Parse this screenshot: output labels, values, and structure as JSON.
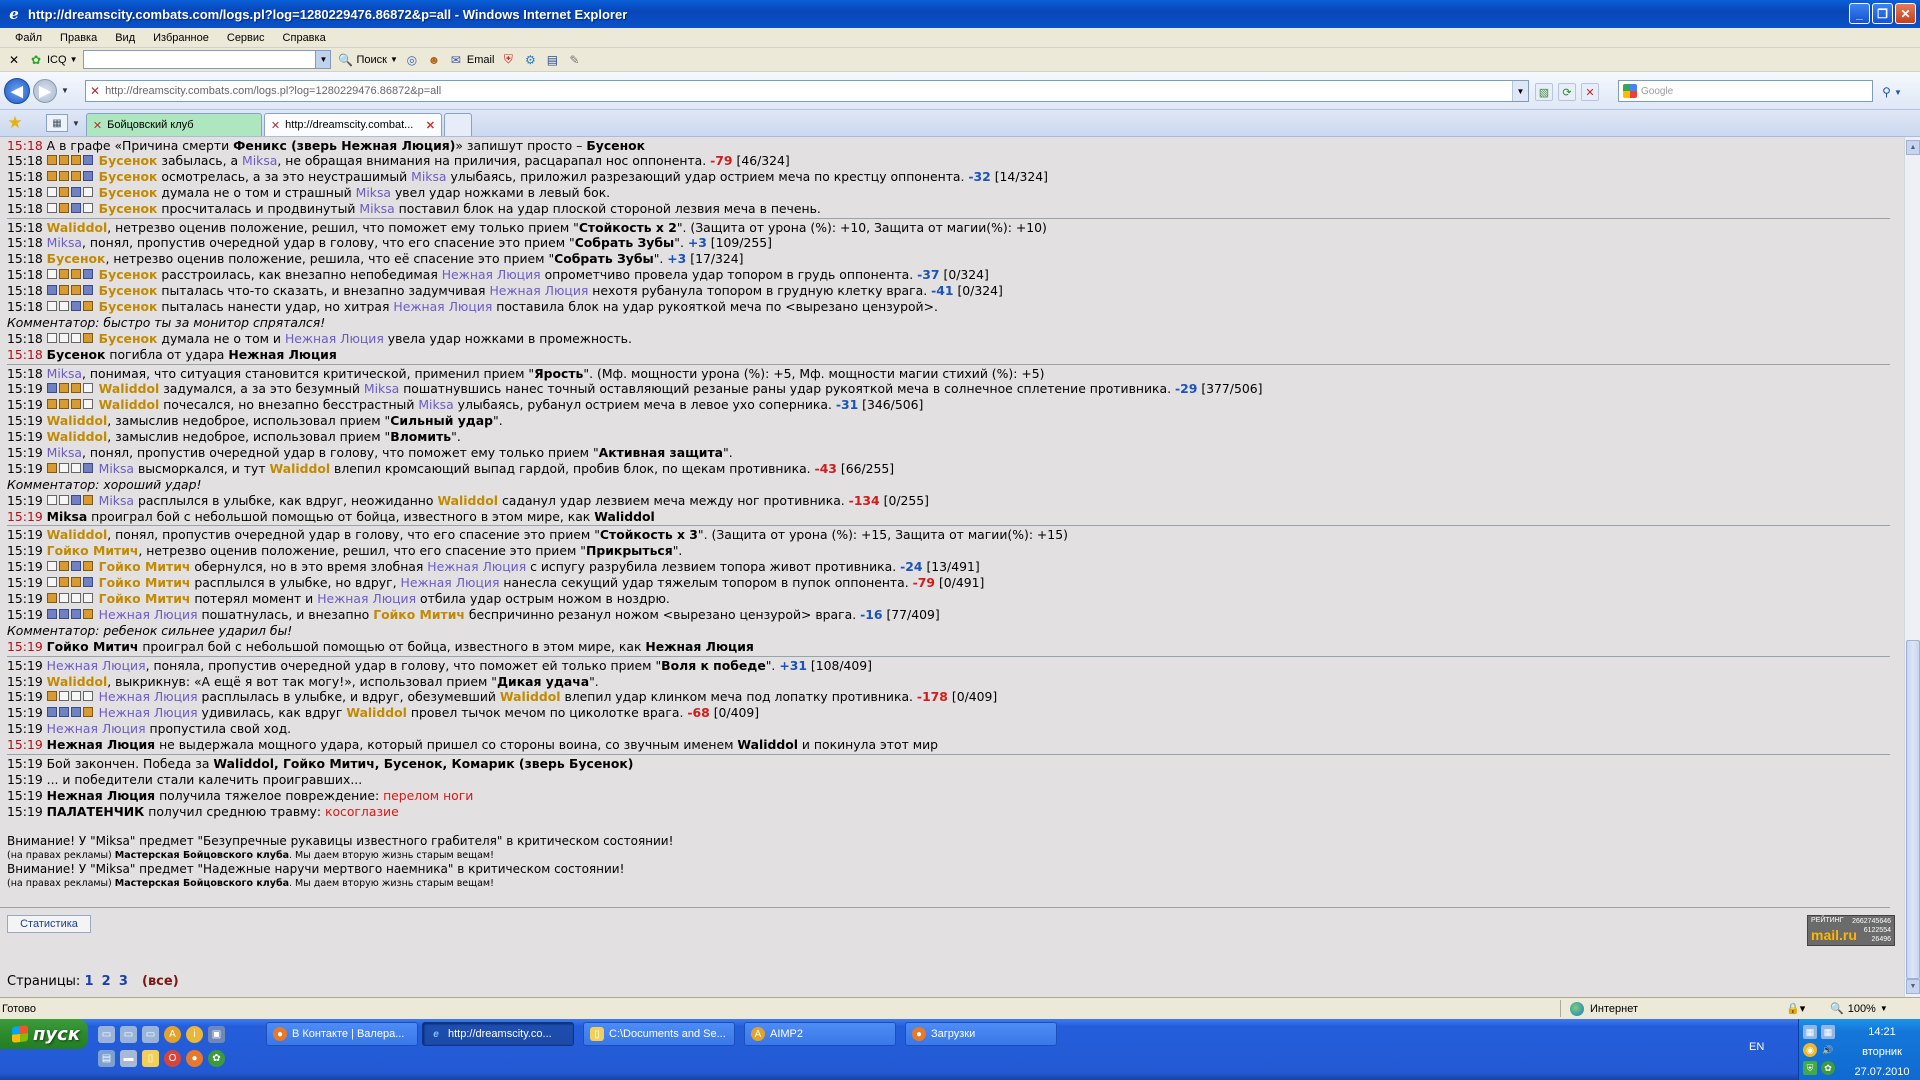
{
  "window": {
    "title": "http://dreamscity.combats.com/logs.pl?log=1280229476.86872&p=all - Windows Internet Explorer",
    "btn_min": "_",
    "btn_max": "❐",
    "btn_close": "✕"
  },
  "menu": [
    "Файл",
    "Правка",
    "Вид",
    "Избранное",
    "Сервис",
    "Справка"
  ],
  "toolbar": {
    "icq_label": "ICQ",
    "search_label": "Поиск",
    "email_label": "Email"
  },
  "address": {
    "url": "http://dreamscity.combats.com/logs.pl?log=1280229476.86872&p=all",
    "search_placeholder": "Google"
  },
  "tabs": [
    {
      "label": "Бойцовский клуб"
    },
    {
      "label": "http://dreamscity.combat..."
    }
  ],
  "log": [
    {
      "t": "15:18",
      "red": true,
      "first": true,
      "html": "А в графе «Причина смерти <span class=\"b\">Феникс (зверь Нежная Люция)</span>» запишут просто – <span class=\"b\">Бусенок</span>"
    },
    {
      "t": "15:18",
      "ico": "fffb",
      "html": "<span class=\"p1\">Бусенок</span> забылась, а <span class=\"p2\">Miksa</span>, не обращая внимания на приличия, расцарапал нос оппонента. <span class=\"dmg\">-79</span> [46/324]"
    },
    {
      "t": "15:18",
      "ico": "fffb",
      "html": "<span class=\"p1\">Бусенок</span> осмотрелась, а за это неустрашимый <span class=\"p2\">Miksa</span> улыбаясь, приложил разрезающий удар острием меча по крестцу оппонента. <span class=\"heal\">-32</span> [14/324]"
    },
    {
      "t": "15:18",
      "ico": "efbe",
      "html": "<span class=\"p1\">Бусенок</span> думала не о том и страшный <span class=\"p2\">Miksa</span> увел удар ножками в левый бок."
    },
    {
      "t": "15:18",
      "ico": "efbe",
      "html": "<span class=\"p1\">Бусенок</span> просчиталась и продвинутый <span class=\"p2\">Miksa</span> поставил блок на удар плоской стороной лезвия меча в печень."
    },
    {
      "sep": true
    },
    {
      "t": "15:18",
      "html": "<span class=\"p1\">Waliddol</span>, нетрезво оценив положение, решил, что поможет ему только прием \"<span class=\"b\">Стойкость x 2</span>\". (Защита от урона (%): +10, Защита от магии(%): +10)"
    },
    {
      "t": "15:18",
      "html": "<span class=\"p2\">Miksa</span>, понял, пропустив очередной удар в голову, что его спасение это прием \"<span class=\"b\">Собрать Зубы</span>\". <span class=\"heal\">+3</span> [109/255]"
    },
    {
      "t": "15:18",
      "html": "<span class=\"p1\">Бусенок</span>, нетрезво оценив положение, решила, что её спасение это прием \"<span class=\"b\">Собрать Зубы</span>\". <span class=\"heal\">+3</span> [17/324]"
    },
    {
      "t": "15:18",
      "ico": "effb",
      "html": "<span class=\"p1\">Бусенок</span> расстроилась, как внезапно непобедимая <span class=\"p2\">Нежная Люция</span> опрометчиво провела удар топором в грудь оппонента. <span class=\"heal\">-37</span> [0/324]"
    },
    {
      "t": "15:18",
      "ico": "bffb",
      "html": "<span class=\"p1\">Бусенок</span> пыталась что-то сказать, и внезапно задумчивая <span class=\"p2\">Нежная Люция</span> нехотя рубанула топором в грудную клетку врага. <span class=\"heal\">-41</span> [0/324]"
    },
    {
      "t": "15:18",
      "ico": "eebf",
      "html": "<span class=\"p1\">Бусенок</span> пыталась нанести удар, но хитрая <span class=\"p2\">Нежная Люция</span> поставила блок на удар рукояткой меча по &lt;вырезано цензурой&gt;."
    },
    {
      "com": true,
      "html": "Комментатор: быстро ты за монитор спрятался!"
    },
    {
      "t": "15:18",
      "ico": "eeef",
      "html": "<span class=\"p1\">Бусенок</span> думала не о том и <span class=\"p2\">Нежная Люция</span> увела удар ножками в промежность."
    },
    {
      "t": "15:18",
      "red": true,
      "html": "<span class=\"b\">Бусенок</span> погибла от удара <span class=\"b\">Нежная Люция</span>"
    },
    {
      "sep": true
    },
    {
      "t": "15:18",
      "html": "<span class=\"p2\">Miksa</span>, понимая, что ситуация становится критической, применил прием \"<span class=\"b\">Ярость</span>\". (Мф. мощности урона (%): +5, Мф. мощности магии стихий (%): +5)"
    },
    {
      "t": "15:19",
      "ico": "bffe",
      "html": "<span class=\"p1\">Waliddol</span> задумался, а за это безумный <span class=\"p2\">Miksa</span> пошатнувшись нанес точный оставляющий резаные раны удар рукояткой меча в солнечное сплетение противника. <span class=\"heal\">-29</span> [377/506]"
    },
    {
      "t": "15:19",
      "ico": "fffe",
      "html": "<span class=\"p1\">Waliddol</span> почесался, но внезапно бесстрастный <span class=\"p2\">Miksa</span> улыбаясь, рубанул острием меча в левое ухо соперника. <span class=\"heal\">-31</span> [346/506]"
    },
    {
      "t": "15:19",
      "html": "<span class=\"p1\">Waliddol</span>, замыслив недоброе, использовал прием \"<span class=\"b\">Сильный удар</span>\"."
    },
    {
      "t": "15:19",
      "html": "<span class=\"p1\">Waliddol</span>, замыслив недоброе, использовал прием \"<span class=\"b\">Вломить</span>\"."
    },
    {
      "t": "15:19",
      "html": "<span class=\"p2\">Miksa</span>, понял, пропустив очередной удар в голову, что поможет ему только прием \"<span class=\"b\">Активная защита</span>\"."
    },
    {
      "t": "15:19",
      "ico": "feeb",
      "html": "<span class=\"p2\">Miksa</span> высморкался, и тут <span class=\"p1\">Waliddol</span> влепил кромсающий выпад гардой, пробив блок, по щекам противника. <span class=\"dmg\">-43</span> [66/255]"
    },
    {
      "com": true,
      "html": "Комментатор: хороший удар!"
    },
    {
      "t": "15:19",
      "ico": "eebf",
      "html": "<span class=\"p2\">Miksa</span> расплылся в улыбке, как вдруг, неожиданно <span class=\"p1\">Waliddol</span> саданул удар лезвием меча между ног противника. <span class=\"dmg\">-134</span> [0/255]"
    },
    {
      "t": "15:19",
      "red": true,
      "html": "<span class=\"b\">Miksa</span> проиграл бой с небольшой помощью от бойца, известного в этом мире, как <span class=\"b\">Waliddol</span>"
    },
    {
      "sep": true
    },
    {
      "t": "15:19",
      "html": "<span class=\"p1\">Waliddol</span>, понял, пропустив очередной удар в голову, что его спасение это прием \"<span class=\"b\">Стойкость x 3</span>\". (Защита от урона (%): +15, Защита от магии(%): +15)"
    },
    {
      "t": "15:19",
      "html": "<span class=\"p1\">Гойко Митич</span>, нетрезво оценив положение, решил, что его спасение это прием \"<span class=\"b\">Прикрыться</span>\"."
    },
    {
      "t": "15:19",
      "ico": "efbf",
      "html": "<span class=\"p1\">Гойко Митич</span> обернулся, но в это время злобная <span class=\"p2\">Нежная Люция</span> с испугу разрубила лезвием топора живот противника. <span class=\"heal\">-24</span> [13/491]"
    },
    {
      "t": "15:19",
      "ico": "effb",
      "html": "<span class=\"p1\">Гойко Митич</span> расплылся в улыбке, но вдруг, <span class=\"p2\">Нежная Люция</span> нанесла секущий удар тяжелым топором в пупок оппонента. <span class=\"dmg\">-79</span> [0/491]"
    },
    {
      "t": "15:19",
      "ico": "feee",
      "html": "<span class=\"p1\">Гойко Митич</span> потерял момент и <span class=\"p2\">Нежная Люция</span> отбила удар острым ножом в ноздрю."
    },
    {
      "t": "15:19",
      "ico": "bbbf",
      "html": "<span class=\"p2\">Нежная Люция</span> пошатнулась, и внезапно <span class=\"p1\">Гойко Митич</span> беспричинно резанул ножом &lt;вырезано цензурой&gt; врага. <span class=\"heal\">-16</span> [77/409]"
    },
    {
      "com": true,
      "html": "Комментатор: ребенок сильнее ударил бы!"
    },
    {
      "t": "15:19",
      "red": true,
      "html": "<span class=\"b\">Гойко Митич</span> проиграл бой с небольшой помощью от бойца, известного в этом мире, как <span class=\"b\">Нежная Люция</span>"
    },
    {
      "sep": true
    },
    {
      "t": "15:19",
      "html": "<span class=\"p2\">Нежная Люция</span>, поняла, пропустив очередной удар в голову, что поможет ей только прием \"<span class=\"b\">Воля к победе</span>\". <span class=\"heal\">+31</span> [108/409]"
    },
    {
      "t": "15:19",
      "html": "<span class=\"p1\">Waliddol</span>, выкрикнув: «А ещё я вот так могу!», использовал прием \"<span class=\"b\">Дикая удача</span>\"."
    },
    {
      "t": "15:19",
      "ico": "feee",
      "html": "<span class=\"p2\">Нежная Люция</span> расплылась в улыбке, и вдруг, обезумевший <span class=\"p1\">Waliddol</span> влепил удар клинком меча под лопатку противника. <span class=\"dmg\">-178</span> [0/409]"
    },
    {
      "t": "15:19",
      "ico": "bbbf",
      "html": "<span class=\"p2\">Нежная Люция</span> удивилась, как вдруг <span class=\"p1\">Waliddol</span> провел тычок мечом по циколотке врага. <span class=\"dmg\">-68</span> [0/409]"
    },
    {
      "t": "15:19",
      "html": "<span class=\"p2\">Нежная Люция</span> пропустила свой ход."
    },
    {
      "t": "15:19",
      "red": true,
      "html": "<span class=\"b\">Нежная Люция</span> не выдержала мощного удара, который пришел со стороны воина, со звучным именем <span class=\"b\">Waliddol</span> и покинула этот мир"
    },
    {
      "sep": true
    },
    {
      "t": "15:19",
      "html": "Бой закончен. Победа за <span class=\"b\">Waliddol, Гойко Митич, Бусенок, Комарик (зверь Бусенок)</span>"
    },
    {
      "t": "15:19",
      "html": "... и победители стали калечить проигравших..."
    },
    {
      "t": "15:19",
      "html": "<span class=\"b\">Нежная Люция</span> получила тяжелое повреждение: <span class=\"inj\">перелом ноги</span>"
    },
    {
      "t": "15:19",
      "html": "<span class=\"b\">ПАЛАТЕНЧИК</span> получил среднюю травму: <span class=\"inj\">косоглазие</span>"
    }
  ],
  "notices": [
    {
      "text": "Внимание! У \"Miksa\" предмет \"Безупречные рукавицы известного грабителя\" в критическом состоянии!"
    },
    {
      "small": true,
      "pre": "(на правах рекламы) ",
      "bold": "Мастерская Бойцовского клуба",
      "post": ". Мы даем вторую жизнь старым вещам!"
    },
    {
      "text": "Внимание! У \"Miksa\" предмет \"Надежные наручи мертвого наемника\" в критическом состоянии!"
    },
    {
      "small": true,
      "pre": "(на правах рекламы) ",
      "bold": "Мастерская Бойцовского клуба",
      "post": ". Мы даем вторую жизнь старым вещам!"
    }
  ],
  "stats_button": "Статистика",
  "counter": {
    "label": "РЕЙТИНГ",
    "brand": "mail.ru",
    "n1": "2662745646",
    "n2": "6122554",
    "n3": "26496"
  },
  "pages": {
    "label": "Страницы:",
    "items": [
      "1",
      "2",
      "3"
    ],
    "all": "(все)"
  },
  "status": {
    "ready": "Готово",
    "zone": "Интернет",
    "zoom": "100%"
  },
  "taskbar": {
    "start": "пуск",
    "tasks": [
      "В Контакте | Валера...",
      "http://dreamscity.co...",
      "C:\\Documents and Se...",
      "AIMP2",
      "Загрузки"
    ],
    "lang": "EN",
    "time": "14:21",
    "day": "вторник",
    "date": "27.07.2010"
  }
}
